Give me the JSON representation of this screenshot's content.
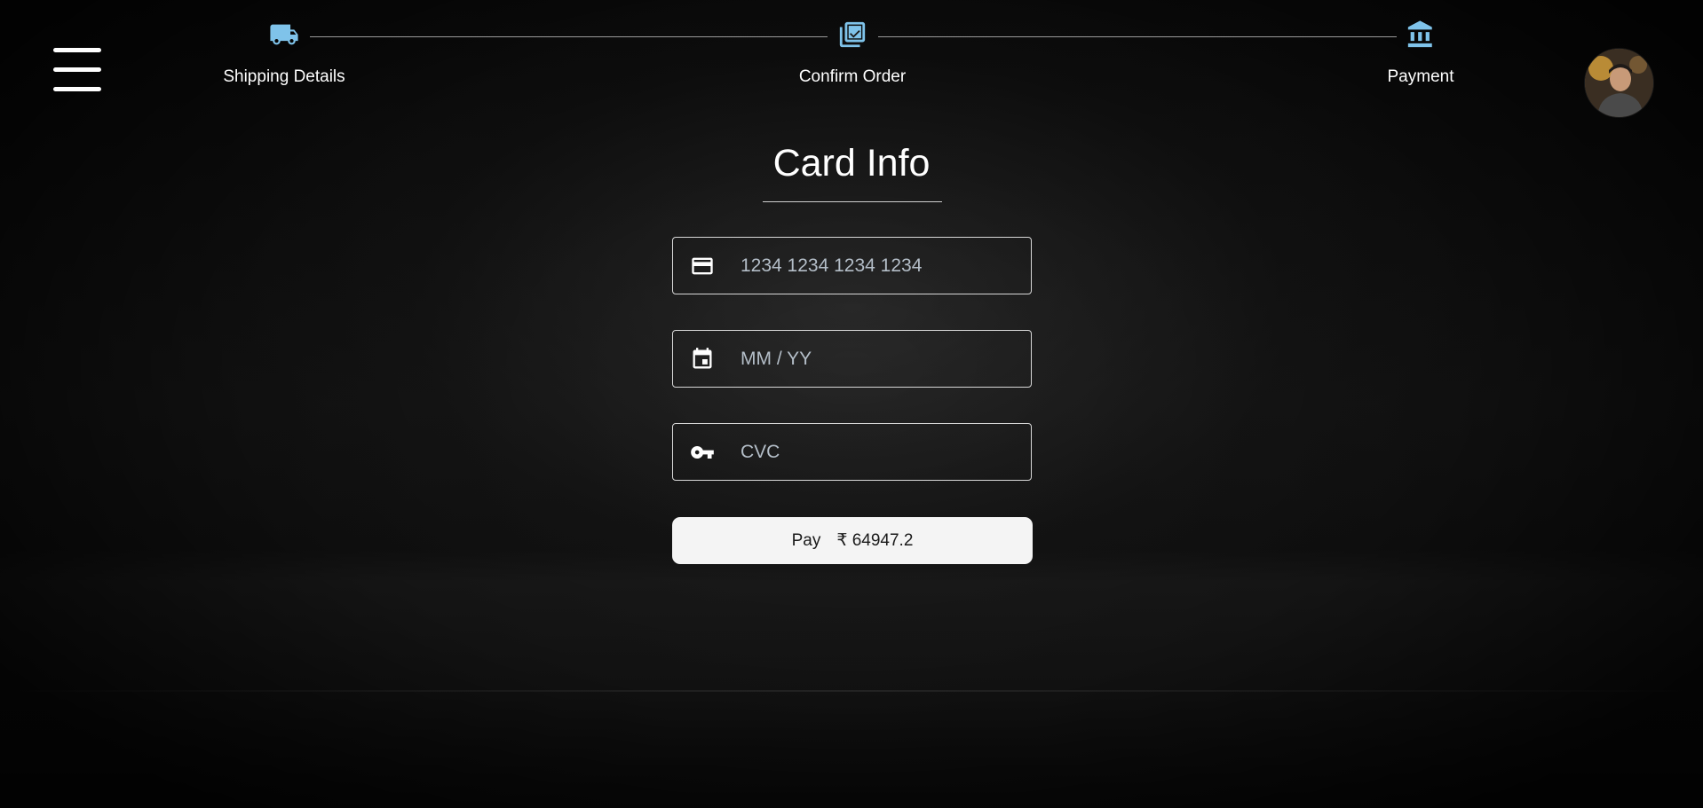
{
  "header": {
    "menu_icon": "hamburger-menu-icon",
    "avatar_icon": "user-avatar"
  },
  "stepper": {
    "accent_color": "#7fc3ea",
    "steps": [
      {
        "label": "Shipping Details",
        "icon": "truck-icon"
      },
      {
        "label": "Confirm Order",
        "icon": "checklist-icon"
      },
      {
        "label": "Payment",
        "icon": "bank-icon"
      }
    ]
  },
  "card": {
    "title": "Card Info",
    "fields": [
      {
        "placeholder": "1234 1234 1234 1234",
        "value": "",
        "icon": "credit-card-icon"
      },
      {
        "placeholder": "MM / YY",
        "value": "",
        "icon": "calendar-event-icon"
      },
      {
        "placeholder": "CVC",
        "value": "",
        "icon": "key-icon"
      }
    ],
    "pay_label": "Pay",
    "pay_amount": "₹ 64947.2"
  }
}
